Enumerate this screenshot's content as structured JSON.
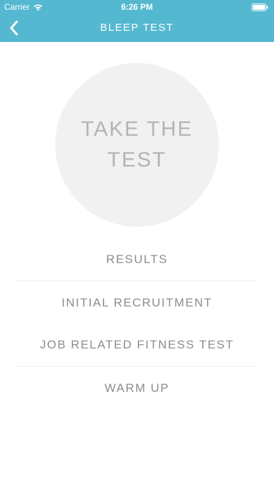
{
  "status_bar": {
    "carrier": "Carrier",
    "time": "6:26 PM",
    "icons": [
      "wifi-icon",
      "battery-icon"
    ]
  },
  "nav": {
    "title": "BLEEP TEST",
    "back_icon": "chevron-left-icon"
  },
  "main": {
    "take_test_label": "TAKE THE TEST"
  },
  "menu": {
    "items": [
      {
        "label": "RESULTS"
      },
      {
        "label": "INITIAL RECRUITMENT"
      },
      {
        "label": "JOB RELATED FITNESS TEST"
      },
      {
        "label": "WARM UP"
      }
    ]
  },
  "colors": {
    "header": "#55b8d1",
    "circle": "#f1f1f1",
    "menu_text": "#8c8c8c",
    "circle_text": "#b4b4b4"
  }
}
